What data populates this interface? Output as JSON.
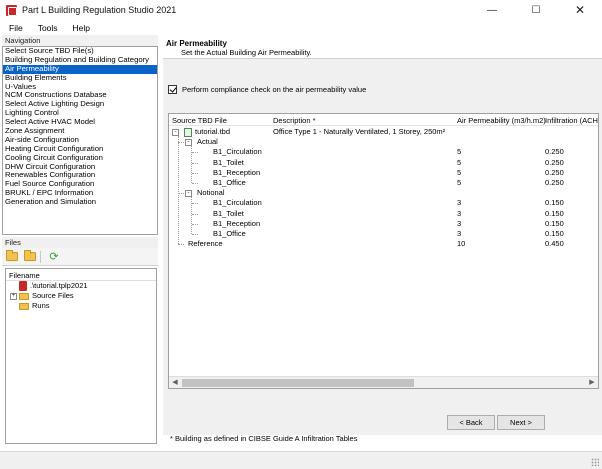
{
  "window": {
    "title": "Part L Building Regulation Studio 2021",
    "minimize": "—",
    "maximize": "☐",
    "close": "✕"
  },
  "menu": [
    "File",
    "Tools",
    "Help"
  ],
  "navigation": {
    "header": "Navigation",
    "selected_index": 2,
    "items": [
      "Select Source TBD File(s)",
      "Building Regulation and Building Category",
      "Air Permeability",
      "Building Elements",
      "U-Values",
      "NCM Constructions Database",
      "Select Active Lighting Design",
      "Lighting Control",
      "Select Active HVAC Model",
      "Zone Assignment",
      "Air-side Configuration",
      "Heating Circuit Configuration",
      "Cooling Circuit Configuration",
      "DHW Circuit Configuration",
      "Renewables Configuration",
      "Fuel Source Configuration",
      "BRUKL / EPC Information",
      "Generation and Simulation"
    ]
  },
  "files": {
    "header": "Files",
    "tree_header": "Filename",
    "items": [
      {
        "label": ".\\tutorial.tplp2021",
        "icon": "tpl-file-icon",
        "indent": 1,
        "expander": ""
      },
      {
        "label": "Source Files",
        "icon": "folder-icon",
        "indent": 0,
        "expander": "+"
      },
      {
        "label": "Runs",
        "icon": "folder-icon",
        "indent": 1,
        "expander": ""
      }
    ]
  },
  "content": {
    "title": "Air Permeability",
    "subtitle": "Set the Actual Building Air Permeability.",
    "checkbox_label": "Perform compliance check on the air permeability value",
    "checkbox_checked": true,
    "columns": [
      "Source TBD File",
      "Description *",
      "Air Permeability (m3/h.m2)",
      "Infiltration (ACH)"
    ],
    "rows": [
      {
        "level": 0,
        "label": "tutorial.tbd",
        "description": "Office Type 1 - Naturally Ventilated, 1 Storey, 250m²",
        "ap": "",
        "inf": "",
        "expander": "-",
        "icon": true
      },
      {
        "level": 1,
        "label": "Actual",
        "description": "",
        "ap": "",
        "inf": "",
        "expander": "-",
        "icon": false
      },
      {
        "level": 2,
        "label": "B1_Circulation",
        "description": "",
        "ap": "5",
        "inf": "0.250",
        "expander": "",
        "icon": false
      },
      {
        "level": 2,
        "label": "B1_Toilet",
        "description": "",
        "ap": "5",
        "inf": "0.250",
        "expander": "",
        "icon": false
      },
      {
        "level": 2,
        "label": "B1_Reception",
        "description": "",
        "ap": "5",
        "inf": "0.250",
        "expander": "",
        "icon": false
      },
      {
        "level": 2,
        "label": "B1_Office",
        "description": "",
        "ap": "5",
        "inf": "0.250",
        "expander": "",
        "icon": false
      },
      {
        "level": 1,
        "label": "Notional",
        "description": "",
        "ap": "",
        "inf": "",
        "expander": "-",
        "icon": false
      },
      {
        "level": 2,
        "label": "B1_Circulation",
        "description": "",
        "ap": "3",
        "inf": "0.150",
        "expander": "",
        "icon": false
      },
      {
        "level": 2,
        "label": "B1_Toilet",
        "description": "",
        "ap": "3",
        "inf": "0.150",
        "expander": "",
        "icon": false
      },
      {
        "level": 2,
        "label": "B1_Reception",
        "description": "",
        "ap": "3",
        "inf": "0.150",
        "expander": "",
        "icon": false
      },
      {
        "level": 2,
        "label": "B1_Office",
        "description": "",
        "ap": "3",
        "inf": "0.150",
        "expander": "",
        "icon": false
      },
      {
        "level": 1,
        "label": "Reference",
        "description": "",
        "ap": "10",
        "inf": "0.450",
        "expander": "",
        "icon": false
      }
    ],
    "footnote": "* Building as defined in CIBSE Guide A Infiltration Tables"
  },
  "buttons": {
    "back": "< Back",
    "next": "Next >"
  }
}
